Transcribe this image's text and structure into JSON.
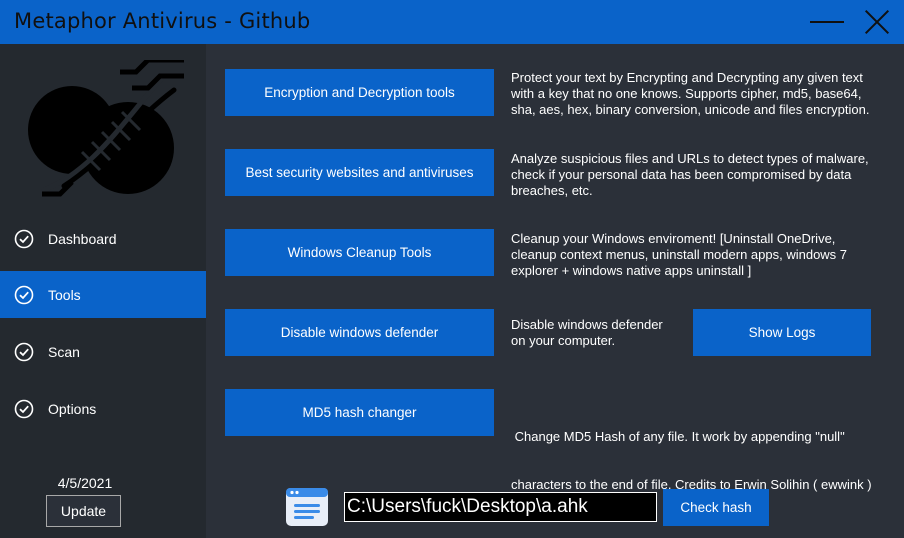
{
  "window": {
    "title": "Metaphor Antivirus - Github",
    "accent": "#0a63c9",
    "background": "#2b3039",
    "sidebar_bg": "#24292f"
  },
  "sidebar": {
    "logo_icon": "dna-circles-logo",
    "items": [
      {
        "label": "Dashboard",
        "icon": "check-circle-icon",
        "active": false
      },
      {
        "label": "Tools",
        "icon": "check-circle-icon",
        "active": true
      },
      {
        "label": "Scan",
        "icon": "check-circle-icon",
        "active": false
      },
      {
        "label": "Options",
        "icon": "check-circle-icon",
        "active": false
      }
    ],
    "date": "4/5/2021",
    "update_label": "Update"
  },
  "tools": [
    {
      "button": "Encryption and Decryption tools",
      "lines": [
        "Protect your text by Encrypting and Decrypting any given text",
        "with a key that no one knows. Supports cipher, md5, base64,",
        "sha, aes, hex, binary conversion, unicode and files encryption."
      ]
    },
    {
      "button": "Best security websites and antiviruses",
      "lines": [
        "Analyze suspicious files and URLs to detect types of malware,",
        "check if your personal data has been compromised by data",
        "breaches, etc."
      ]
    },
    {
      "button": "Windows Cleanup Tools",
      "lines": [
        "Cleanup your Windows enviroment! [Uninstall OneDrive,",
        "cleanup context menus, uninstall modern apps, windows 7",
        "explorer + windows native apps uninstall ]"
      ]
    },
    {
      "button": "Disable windows defender",
      "lines": [
        "Disable windows defender",
        "on your computer."
      ]
    },
    {
      "button": "MD5 hash changer",
      "lines": [
        " Change MD5 Hash of any file. It work by appending \"null\"",
        "characters to the end of file. Credits to Erwin Solihin ( ewwink )"
      ]
    }
  ],
  "show_logs_label": "Show Logs",
  "hash_bar": {
    "icon": "file-list-icon",
    "path_value": "C:\\Users\\fuck\\Desktop\\a.ahk",
    "check_label": "Check hash"
  }
}
